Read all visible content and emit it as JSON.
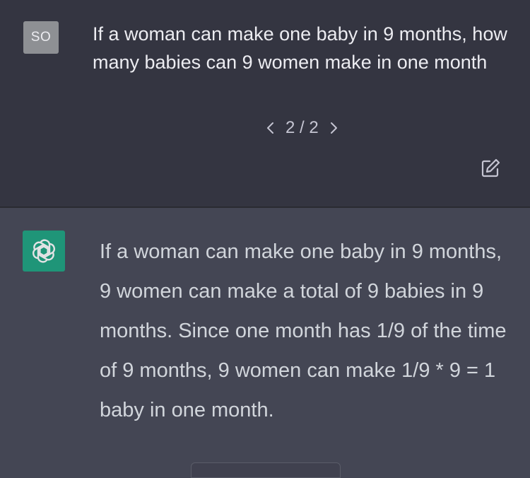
{
  "conversation": {
    "user_message": {
      "avatar_initials": "SO",
      "text": "If a woman can make one baby in 9 months, how many babies can 9 women make in one month",
      "pager": {
        "current_of_total": "2 / 2",
        "prev_icon": "chevron-left-icon",
        "next_icon": "chevron-right-icon"
      },
      "edit_icon": "edit-icon"
    },
    "assistant_message": {
      "avatar_icon": "openai-logo-icon",
      "text": "If a woman can make one baby in 9 months, 9 women can make a total of 9 babies in 9 months. Since one month has 1/9 of the time of 9 months, 9 women can make 1/9 * 9 = 1 baby in one month."
    }
  },
  "colors": {
    "user_bg": "#343541",
    "assistant_bg": "#444654",
    "avatar_user": "#8e9094",
    "avatar_bot": "#19a37f",
    "text_user": "#ececf1",
    "text_assistant": "#d1d5db"
  }
}
